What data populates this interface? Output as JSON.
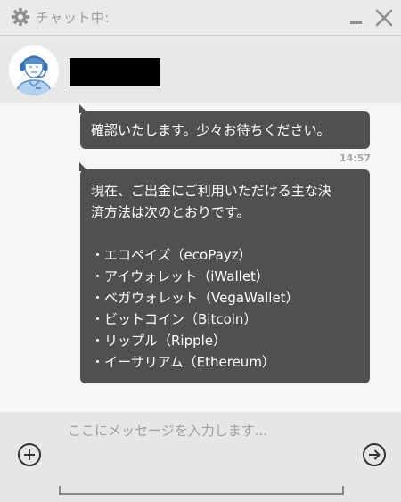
{
  "window": {
    "title": "チャット中:",
    "icons": {
      "settings": "gear-icon",
      "minimize": "minimize-icon",
      "close": "close-icon"
    }
  },
  "agent": {
    "avatar_icon": "operator-headset-avatar",
    "name": ""
  },
  "messages": [
    {
      "sender": "agent",
      "text": "確認いたします。少々お待ちください。"
    },
    {
      "sender": "agent",
      "time": "14:57",
      "paragraph_lines": [
        "現在、ご出金にご利用いただける主な決",
        "済方法は次のとおりです。"
      ],
      "list": [
        "・エコペイズ（ecoPayz）",
        "・アイウォレット（iWallet）",
        "・ベガウォレット（VegaWallet）",
        "・ビットコイン（Bitcoin）",
        "・リップル（Ripple）",
        "・イーサリアム（Ethereum）"
      ]
    }
  ],
  "composer": {
    "placeholder": "ここにメッセージを入力します...",
    "value": "",
    "attach_icon": "plus-circle-icon",
    "send_icon": "arrow-right-circle-icon"
  },
  "colors": {
    "bubble": "#505050",
    "titlebar": "#eaeaea",
    "chat_background": "#f6f6f6",
    "input_background": "#e6e6e6"
  }
}
